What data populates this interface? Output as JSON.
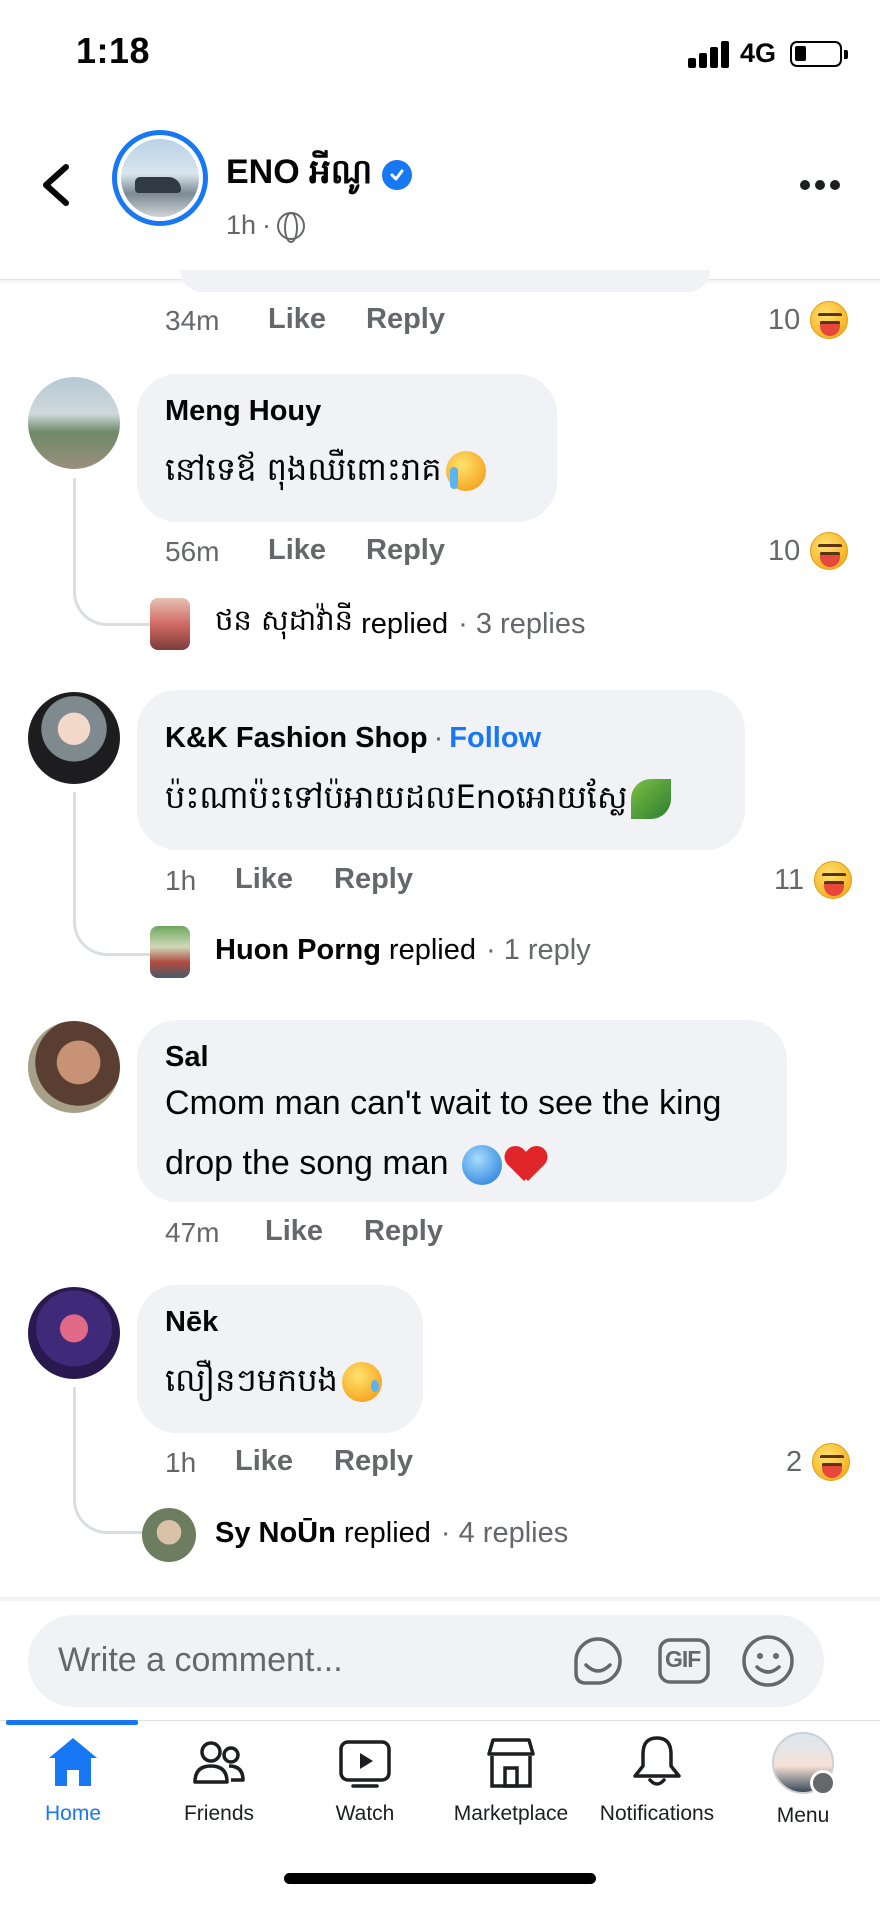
{
  "status_bar": {
    "time": "1:18",
    "network": "4G"
  },
  "header": {
    "page_name": "ENO អីណូ",
    "post_time": "1h",
    "separator": "·"
  },
  "comments": [
    {
      "id": "prev",
      "time": "34m",
      "like": "Like",
      "reply": "Reply",
      "reaction_count": "10"
    },
    {
      "id": "meng",
      "author": "Meng Houy",
      "text": "នៅទេឪ  ពុងឈឺពោះរាគ",
      "time": "56m",
      "like": "Like",
      "reply": "Reply",
      "reaction_count": "10",
      "replied_by": "ថន សុដាវ៉ានី",
      "replied_word": "replied",
      "reply_count": "· 3 replies"
    },
    {
      "id": "kk",
      "author": "K&K Fashion Shop",
      "follow": "Follow",
      "text": "ប៉ះណាប៉ះទៅប៉អាយដលEnoអោយស្លែ",
      "time": "1h",
      "like": "Like",
      "reply": "Reply",
      "reaction_count": "11",
      "replied_by": "Huon Porng",
      "replied_word": "replied",
      "reply_count": "· 1 reply"
    },
    {
      "id": "sal",
      "author": "Sal",
      "text_line1": "Cmom man can't wait to see the king",
      "text_line2": "drop the song man",
      "time": "47m",
      "like": "Like",
      "reply": "Reply"
    },
    {
      "id": "nek",
      "author": "Nēk",
      "text": "លឿនៗមកបង",
      "time": "1h",
      "like": "Like",
      "reply": "Reply",
      "reaction_count": "2",
      "replied_by": "Sy NoŪn",
      "replied_word": "replied",
      "reply_count": "· 4 replies"
    }
  ],
  "composer": {
    "placeholder": "Write a comment...",
    "gif_label": "GIF"
  },
  "nav": [
    {
      "label": "Home",
      "icon": "home-icon",
      "active": true
    },
    {
      "label": "Friends",
      "icon": "friends-icon"
    },
    {
      "label": "Watch",
      "icon": "watch-icon"
    },
    {
      "label": "Marketplace",
      "icon": "marketplace-icon"
    },
    {
      "label": "Notifications",
      "icon": "bell-icon"
    },
    {
      "label": "Menu",
      "icon": "profile-avatar"
    }
  ],
  "colors": {
    "accent": "#1877f2",
    "bubble": "#f0f2f5",
    "muted": "#65676b"
  }
}
